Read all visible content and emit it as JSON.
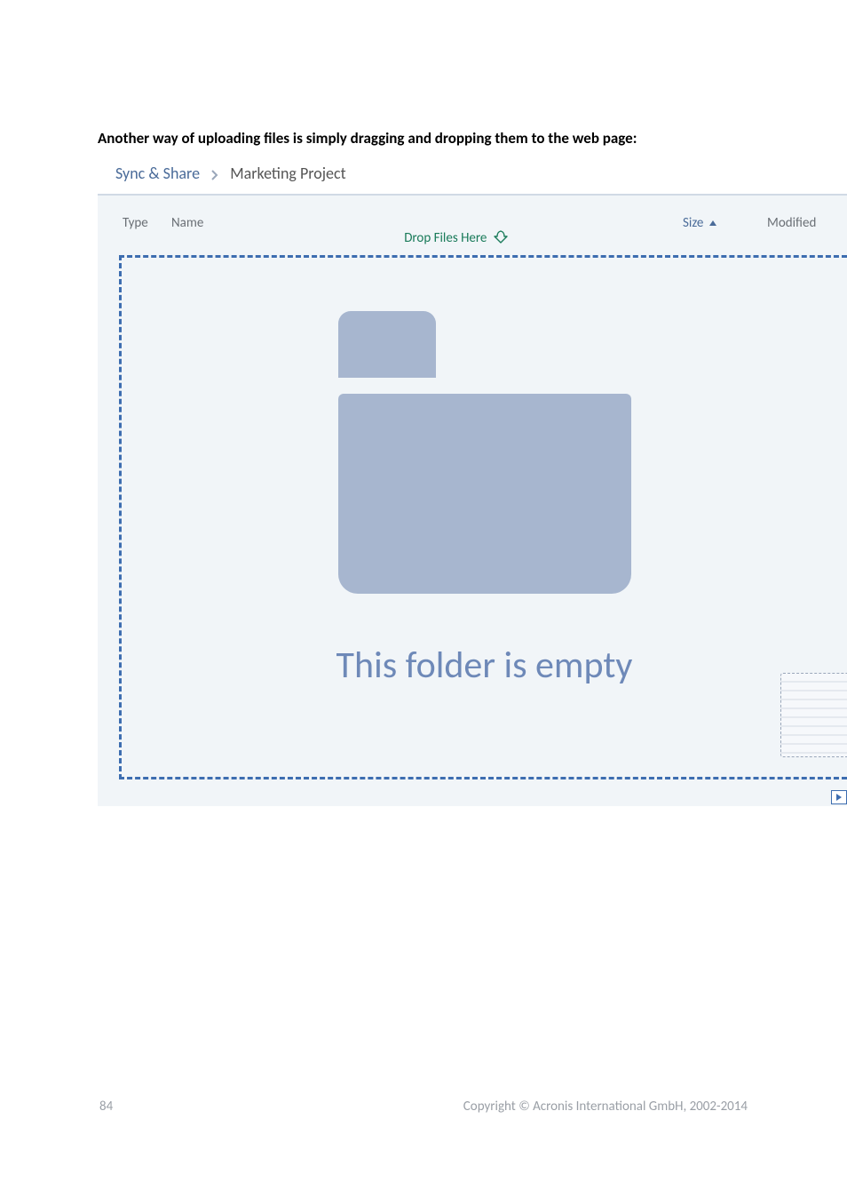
{
  "instruction": "Another way of uploading files is simply dragging and dropping them to the web page:",
  "breadcrumb": {
    "root": "Sync & Share",
    "current": "Marketing Project"
  },
  "columns": {
    "type": "Type",
    "name": "Name",
    "size": "Size",
    "modified": "Modified"
  },
  "drop_label": "Drop Files Here",
  "empty_message": "This folder is empty",
  "footer": {
    "page": "84",
    "copyright": "Copyright © Acronis International GmbH, 2002-2014"
  }
}
